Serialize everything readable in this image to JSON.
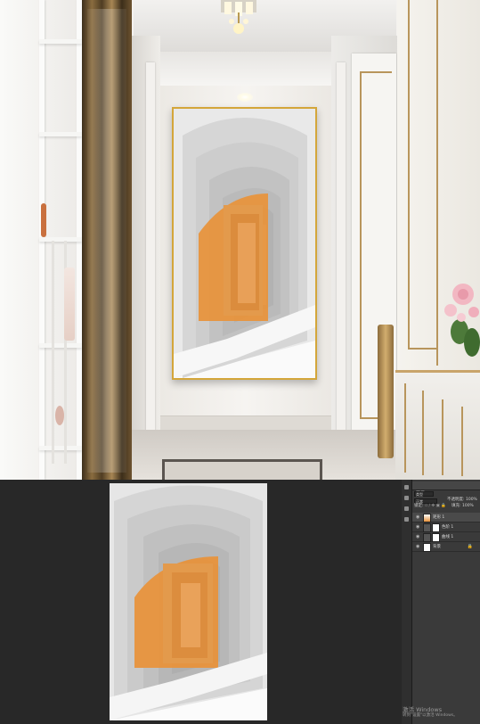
{
  "mockup": {
    "frame_color": "#d4a63a",
    "accent_orange": "#e8923a",
    "art_bg": "#e9e9e9"
  },
  "photoshop": {
    "tab_label": "图层",
    "kind_label": "类型",
    "blend_mode": "正常",
    "opacity_label": "不透明度:",
    "opacity_value": "100%",
    "lock_label": "锁定:",
    "fill_label": "填充:",
    "fill_value": "100%",
    "layers": [
      {
        "name": "矩形 1",
        "selected": true,
        "icon": "image-thumb"
      },
      {
        "name": "色阶 1",
        "selected": false,
        "icon": "adjustment-icon"
      },
      {
        "name": "曲线 1",
        "selected": false,
        "icon": "adjustment-icon"
      },
      {
        "name": "背景",
        "selected": false,
        "icon": "image-thumb"
      }
    ]
  },
  "watermark": {
    "line1": "激活 Windows",
    "line2": "转到\"设置\"以激活 Windows。"
  }
}
